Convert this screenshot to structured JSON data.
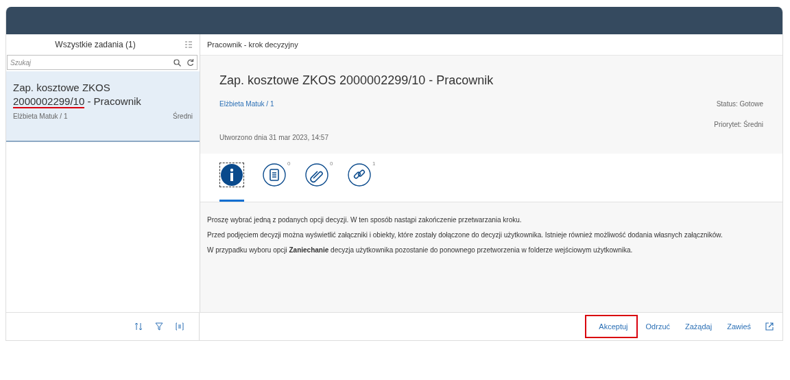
{
  "master": {
    "title": "Wszystkie zadania (1)",
    "search": {
      "placeholder": "Szukaj"
    },
    "items": [
      {
        "title": [
          {
            "text": "Zap. kosztowe ZKOS ",
            "underlined": false
          },
          {
            "text": "2000002299/10",
            "underlined": true
          },
          {
            "text": " - Pracownik",
            "underlined": false
          }
        ],
        "creator": "Elżbieta Matuk / 1",
        "priority": "Średni",
        "selected": true
      }
    ]
  },
  "detail": {
    "title": "Pracownik - krok decyzyjny",
    "header": {
      "title": "Zap. kosztowe ZKOS 2000002299/10 - Pracownik",
      "creator": "Elżbieta Matuk / 1",
      "status": "Status: Gotowe",
      "priority": "Priorytet: Średni",
      "created": "Utworzono dnia 31 mar 2023, 14:57"
    },
    "tabs": [
      {
        "kind": "info",
        "selected": true
      },
      {
        "kind": "notes",
        "count": "0",
        "selected": false
      },
      {
        "kind": "attachments",
        "count": "0",
        "selected": false
      },
      {
        "kind": "links",
        "count": "1",
        "selected": false
      }
    ],
    "paragraphs": [
      "Proszę wybrać jedną z podanych opcji decyzji. W ten sposób nastąpi zakończenie przetwarzania kroku.",
      "Przed podjęciem decyzji można wyświetlić załączniki i obiekty, które zostały dołączone do decyzji użytkownika. Istnieje również możliwość dodania własnych załączników.",
      "W przypadku wyboru opcji **Zaniechanie** decyzja użytkownika pozostanie do ponownego przetworzenia w folderze wejściowym użytkownika."
    ]
  },
  "footer": {
    "actions": [
      {
        "label": "Akceptuj",
        "highlighted": true
      },
      {
        "label": "Odrzuć",
        "highlighted": false
      },
      {
        "label": "Zażądaj",
        "highlighted": false
      },
      {
        "label": "Zawieś",
        "highlighted": false
      }
    ]
  }
}
